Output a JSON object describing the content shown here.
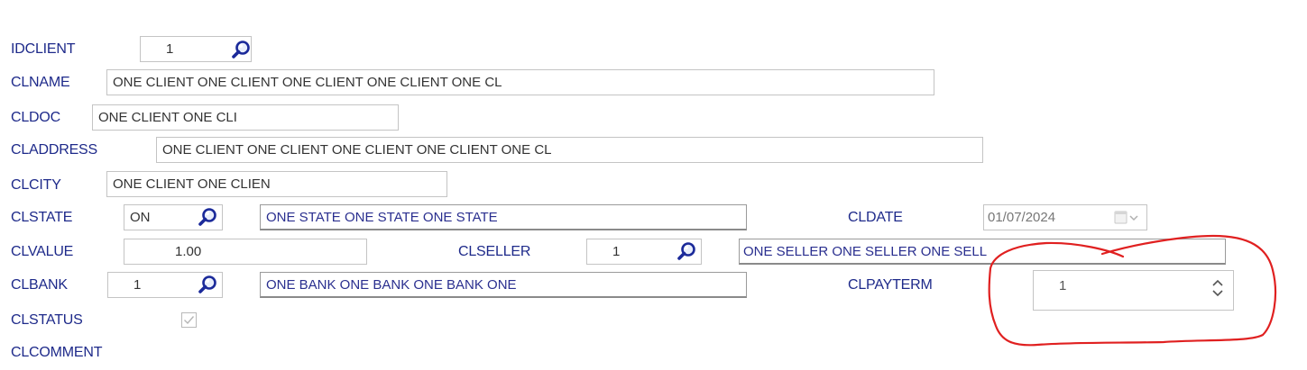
{
  "labels": {
    "idclient": "IDCLIENT",
    "clname": "CLNAME",
    "cldoc": "CLDOC",
    "claddress": "CLADDRESS",
    "clcity": "CLCITY",
    "clstate": "CLSTATE",
    "cldate": "CLDATE",
    "clvalue": "CLVALUE",
    "clseller": "CLSELLER",
    "clbank": "CLBANK",
    "clpayterm": "CLPAYTERM",
    "clstatus": "CLSTATUS",
    "clcomment": "CLCOMMENT"
  },
  "values": {
    "idclient": "1",
    "clname": "ONE CLIENT ONE CLIENT ONE CLIENT ONE CLIENT ONE CL",
    "cldoc": "ONE CLIENT ONE CLI",
    "claddress": "ONE CLIENT ONE CLIENT ONE CLIENT ONE CLIENT ONE CL",
    "clcity": "ONE CLIENT ONE CLIEN",
    "clstate_code": "ON",
    "clstate_name": "ONE STATE ONE STATE ONE STATE",
    "cldate": "01/07/2024",
    "clvalue": "1.00",
    "clseller_id": "1",
    "clseller_name": "ONE SELLER ONE SELLER ONE SELL",
    "clbank_id": "1",
    "clbank_name": "ONE BANK ONE BANK ONE BANK ONE",
    "clpayterm": "1",
    "clstatus_checked": true
  },
  "icons": {
    "lookup": "magnifier-icon",
    "date_picker": "calendar-icon",
    "dropdown": "chevron-down-icon",
    "spin_up": "chevron-up-icon",
    "spin_down": "chevron-down-icon",
    "checkbox": "check-icon"
  },
  "colors": {
    "label": "#1e2a8a",
    "annotation": "#e02020"
  }
}
